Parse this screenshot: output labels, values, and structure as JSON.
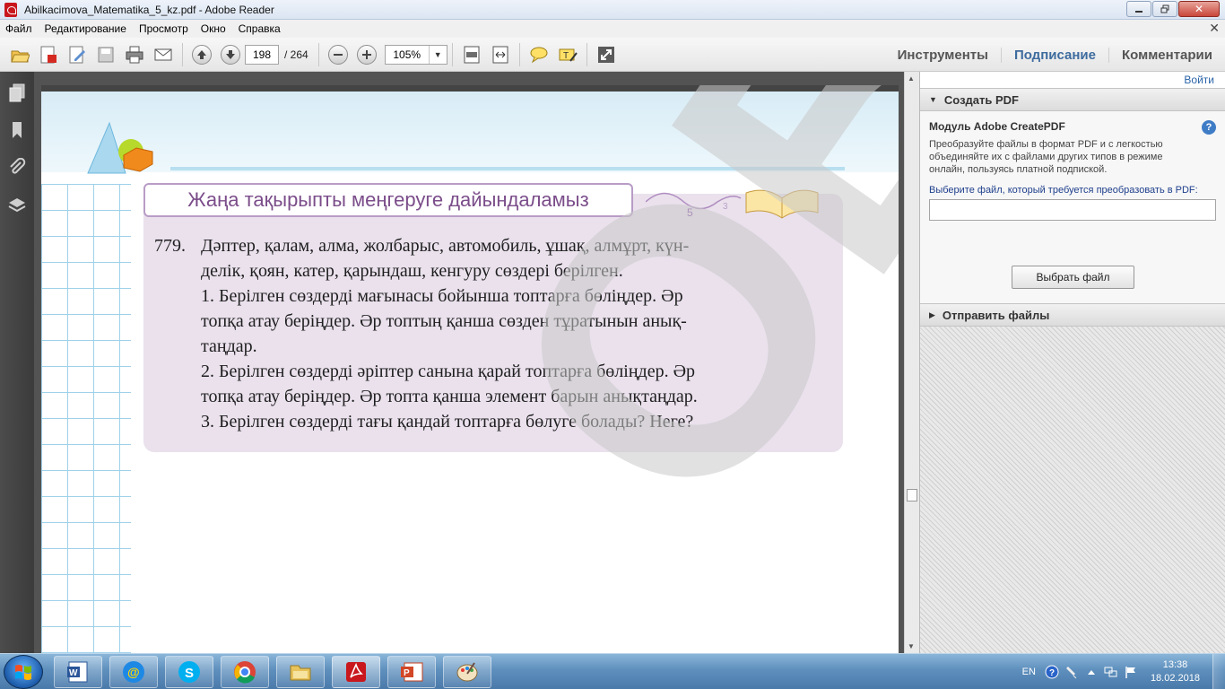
{
  "window": {
    "title": "Abilkacimova_Matematika_5_kz.pdf - Adobe Reader",
    "close_symbol": "✕"
  },
  "menu": {
    "items": [
      "Файл",
      "Редактирование",
      "Просмотр",
      "Окно",
      "Справка"
    ]
  },
  "toolbar": {
    "page_current": "198",
    "page_total": "/ 264",
    "zoom": "105%",
    "tabs": [
      "Инструменты",
      "Подписание",
      "Комментарии"
    ]
  },
  "document": {
    "banner_title": "Жаңа тақырыпты меңгеруге дайындаламыз",
    "problem_number": "779.",
    "problem_lines": [
      "Дәптер, қалам, алма, жолбарыс, автомобиль, ұшақ, алмұрт, күн-",
      "делік, қоян, катер, қарындаш, кенгуру сөздері берілген.",
      "1. Берілген сөздерді мағынасы бойынша топтарға бөліңдер. Әр",
      "топқа атау беріңдер. Әр топтың қанша сөзден тұратынын анық-",
      "таңдар.",
      "2. Берілген сөздерді әріптер санына қарай топтарға бөліңдер. Әр",
      "топқа атау беріңдер. Әр топта қанша элемент барын анықтаңдар.",
      "3. Берілген сөздерді тағы қандай топтарға бөлуге болады? Неге?"
    ],
    "watermark": "ОБА"
  },
  "right_panel": {
    "login_link": "Войти",
    "create_pdf_header": "Создать PDF",
    "module_title": "Модуль Adobe CreatePDF",
    "module_desc": "Преобразуйте файлы в формат PDF и с легкостью объединяйте их с файлами других типов в режиме онлайн, пользуясь платной подпиской.",
    "select_label": "Выберите файл, который требуется преобразовать в PDF:",
    "select_button": "Выбрать файл",
    "send_files_header": "Отправить файлы"
  },
  "taskbar": {
    "lang": "EN",
    "time": "13:38",
    "date": "18.02.2018"
  },
  "colors": {
    "accent": "#3e6b9e",
    "banner_text": "#7b4d8a",
    "card_bg": "#eae1ed"
  }
}
